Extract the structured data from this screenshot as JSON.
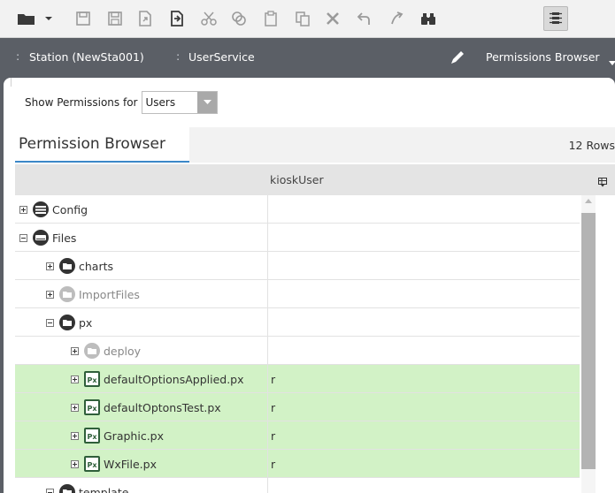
{
  "toolbar": {
    "buttons": [
      "folder-menu-icon",
      "save-icon",
      "save-all-icon",
      "export-icon",
      "import-icon",
      "cut-icon",
      "copy-icon",
      "paste-icon",
      "duplicate-icon",
      "delete-icon",
      "undo-icon",
      "redo-icon",
      "find-icon",
      "list-view-icon"
    ]
  },
  "nav": {
    "station": "Station (NewSta001)",
    "service": "UserService",
    "view": "Permissions Browser"
  },
  "filter": {
    "label": "Show Permissions for",
    "selected": "Users"
  },
  "tab": {
    "title": "Permission Browser",
    "rows_count": "12 Rows"
  },
  "grid": {
    "column": "kioskUser",
    "rows": [
      {
        "name": "Config",
        "perm": "",
        "indent": 0,
        "expand": "plus",
        "icon": "config",
        "dim": false,
        "highlight": false
      },
      {
        "name": "Files",
        "perm": "",
        "indent": 0,
        "expand": "minus",
        "icon": "drive",
        "dim": false,
        "highlight": false
      },
      {
        "name": "charts",
        "perm": "",
        "indent": 1,
        "expand": "plus",
        "icon": "folder",
        "dim": false,
        "highlight": false
      },
      {
        "name": "ImportFiles",
        "perm": "",
        "indent": 1,
        "expand": "plus",
        "icon": "folder-light",
        "dim": true,
        "highlight": false
      },
      {
        "name": "px",
        "perm": "",
        "indent": 1,
        "expand": "minus",
        "icon": "folder",
        "dim": false,
        "highlight": false
      },
      {
        "name": "deploy",
        "perm": "",
        "indent": 2,
        "expand": "plus",
        "icon": "folder-light",
        "dim": true,
        "highlight": false
      },
      {
        "name": "defaultOptionsApplied.px",
        "perm": "r",
        "indent": 2,
        "expand": "plus",
        "icon": "px",
        "dim": false,
        "highlight": true
      },
      {
        "name": "defaultOptonsTest.px",
        "perm": "r",
        "indent": 2,
        "expand": "plus",
        "icon": "px",
        "dim": false,
        "highlight": true
      },
      {
        "name": "Graphic.px",
        "perm": "r",
        "indent": 2,
        "expand": "plus",
        "icon": "px",
        "dim": false,
        "highlight": true
      },
      {
        "name": "WxFile.px",
        "perm": "r",
        "indent": 2,
        "expand": "plus",
        "icon": "px",
        "dim": false,
        "highlight": true
      },
      {
        "name": "template",
        "perm": "",
        "indent": 1,
        "expand": "minus",
        "icon": "folder",
        "dim": false,
        "highlight": false
      }
    ]
  },
  "icons": {
    "px_badge": "Px"
  },
  "colors": {
    "toolbar_bg": "#f2f2f2",
    "navbar_bg": "#5b5f66",
    "highlight_row": "#d2f2c6",
    "tab_underline": "#3b87c8"
  }
}
